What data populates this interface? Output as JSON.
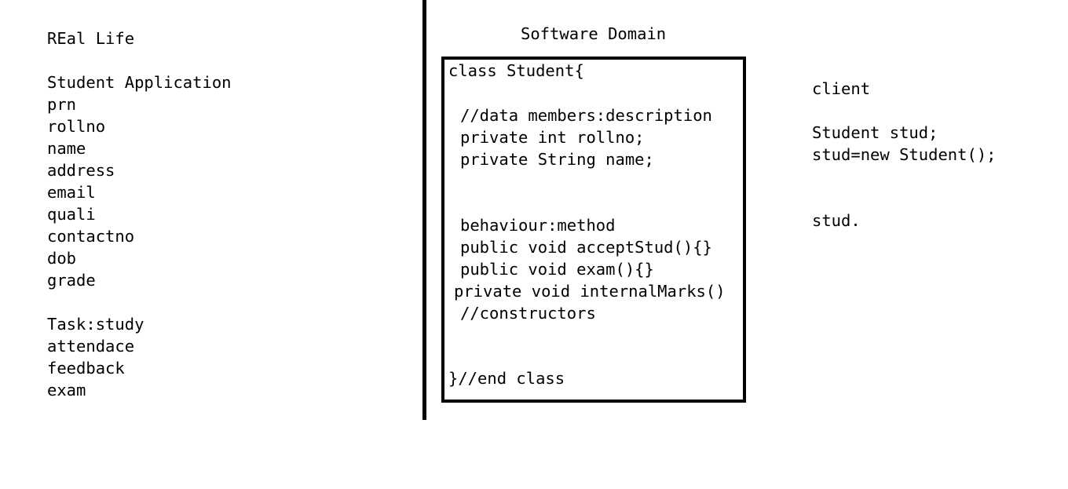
{
  "real_life": {
    "heading": "REal Life",
    "app_title": "Student Application",
    "attributes": [
      "prn",
      "rollno",
      "name",
      "address",
      "email",
      "quali",
      "contactno",
      "dob",
      "grade"
    ],
    "tasks": [
      "Task:study",
      "attendace",
      "feedback",
      "exam"
    ]
  },
  "software_domain": {
    "heading": "Software Domain",
    "code_lines": [
      "class Student{",
      "//data members:description",
      "private int rollno;",
      "private String name;",
      "behaviour:method",
      "public void acceptStud(){}",
      "public void exam(){}",
      "private void internalMarks()",
      "//constructors",
      "}//end class"
    ]
  },
  "client": {
    "heading": "client",
    "lines": [
      "Student stud;",
      "stud=new Student();",
      "stud."
    ]
  }
}
